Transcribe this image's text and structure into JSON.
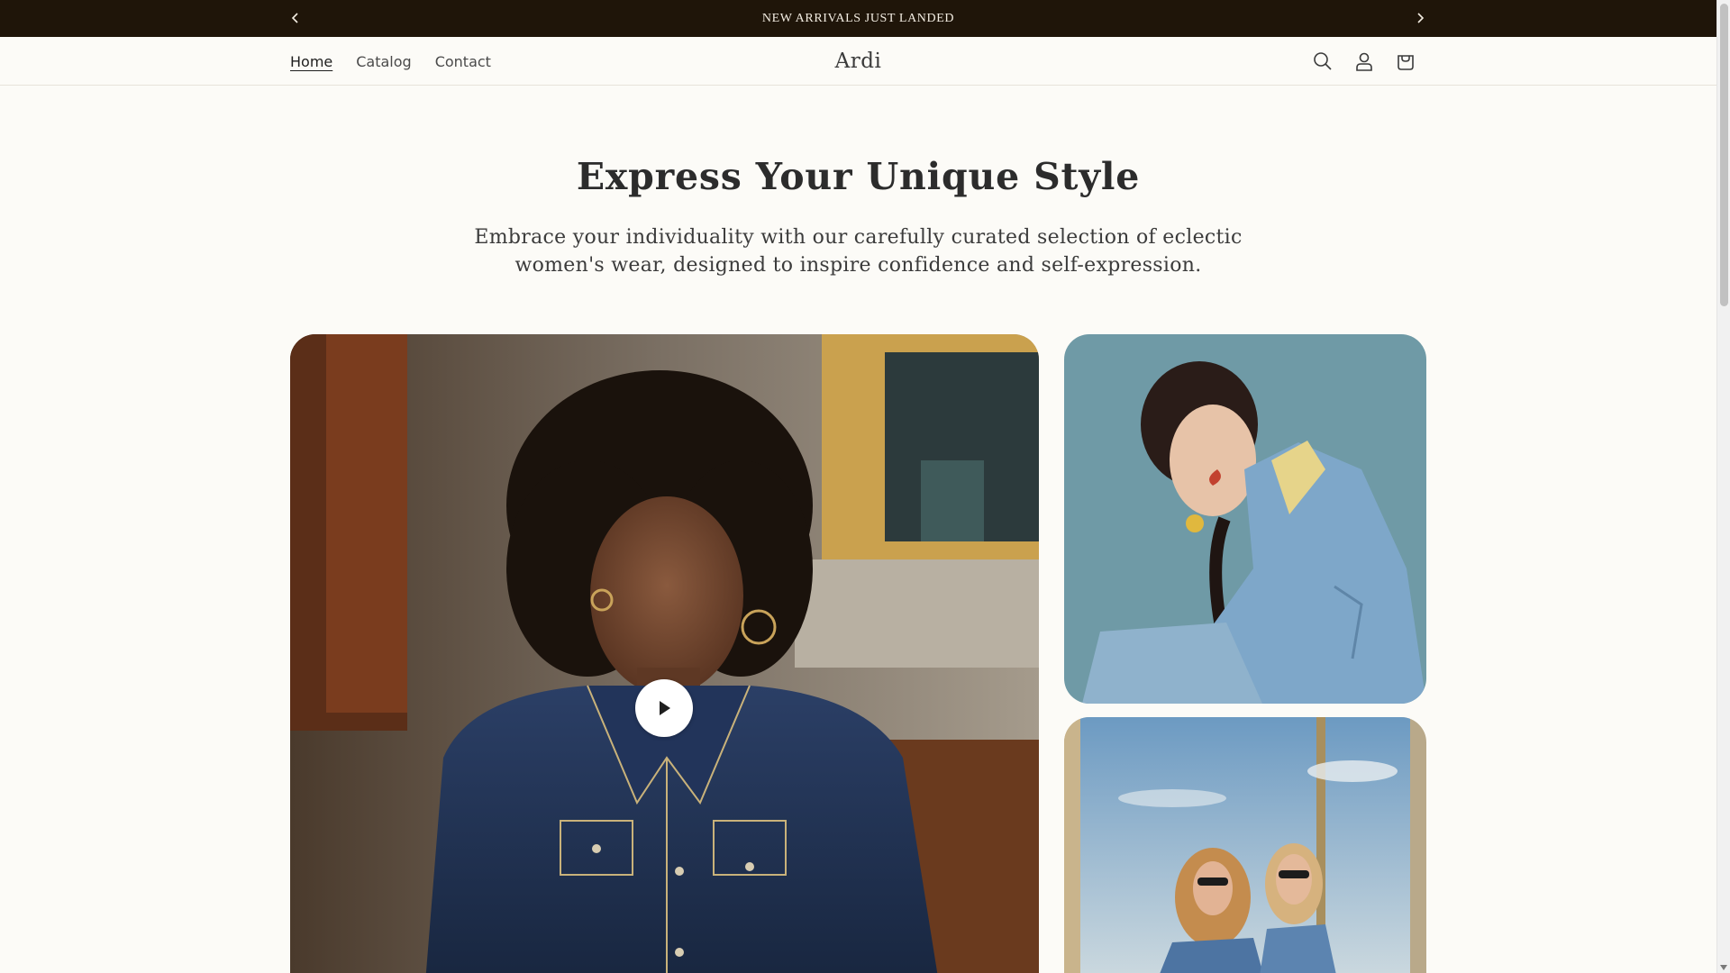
{
  "announcement": {
    "text": "NEW ARRIVALS JUST LANDED",
    "prev_icon": "chevron-left-icon",
    "next_icon": "chevron-right-icon"
  },
  "header": {
    "nav": [
      {
        "label": "Home",
        "active": true
      },
      {
        "label": "Catalog",
        "active": false
      },
      {
        "label": "Contact",
        "active": false
      }
    ],
    "logo": "Ardi",
    "icons": [
      "search-icon",
      "account-icon",
      "cart-icon"
    ]
  },
  "hero": {
    "title": "Express Your Unique Style",
    "subtitle_line1": "Embrace your individuality with our carefully curated selection of eclectic",
    "subtitle_line2": "women's wear, designed to inspire confidence and self-expression."
  },
  "media": {
    "main": {
      "kind": "video",
      "play_icon": "play-icon"
    },
    "side": [
      {
        "kind": "image"
      },
      {
        "kind": "image"
      }
    ]
  },
  "colors": {
    "announcement_bg": "#1f1509",
    "page_bg": "#fcfbf7",
    "text": "#2c2c2c"
  }
}
